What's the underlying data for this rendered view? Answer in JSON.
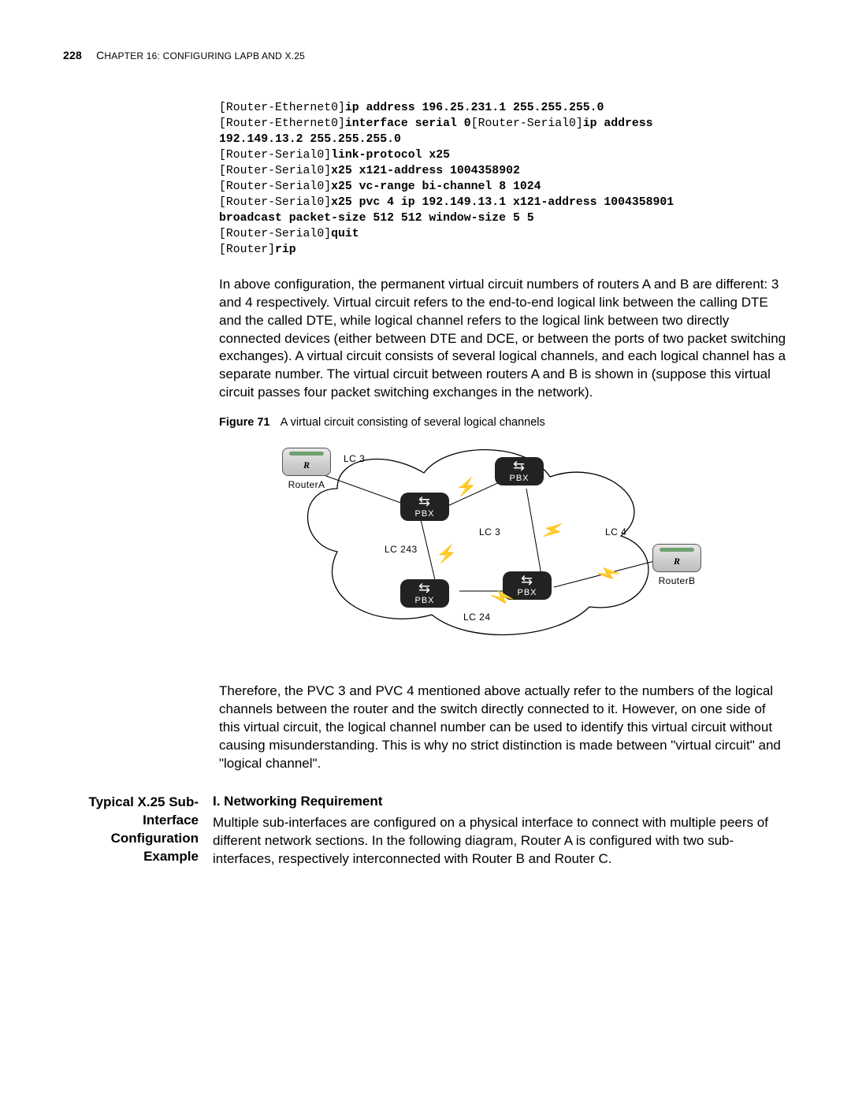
{
  "header": {
    "page_number": "228",
    "chapter_small_caps_prefix": "C",
    "chapter_rest": "HAPTER 16: CONFIGURING LAPB AND X.25"
  },
  "code": {
    "l1_prefix": "[Router-Ethernet0]",
    "l1_cmd": "ip address 196.25.231.1 255.255.255.0",
    "l2_prefix": "[Router-Ethernet0]",
    "l2_cmd": "interface serial 0",
    "l2_mid": "[Router-Serial0]",
    "l2_cmd2": "ip address",
    "l3_cmd": "192.149.13.2 255.255.255.0",
    "l4_prefix": "[Router-Serial0]",
    "l4_cmd": "link-protocol x25",
    "l5_prefix": "[Router-Serial0]",
    "l5_cmd": "x25 x121-address 1004358902",
    "l6_prefix": "[Router-Serial0]",
    "l6_cmd": "x25 vc-range bi-channel 8 1024",
    "l7_prefix": "[Router-Serial0]",
    "l7_cmd": "x25 pvc 4 ip 192.149.13.1 x121-address 1004358901",
    "l8_cmd": "broadcast packet-size 512 512 window-size 5 5",
    "l9_prefix": "[Router-Serial0]",
    "l9_cmd": "quit",
    "l10_prefix": "[Router]",
    "l10_cmd": "rip"
  },
  "para1": "In above configuration, the permanent virtual circuit numbers of routers A and B are different: 3 and 4 respectively. Virtual circuit refers to the end-to-end logical link between the calling DTE and the called DTE, while logical channel refers to the logical link between two directly connected devices (either between DTE and DCE, or between the ports of two packet switching exchanges). A virtual circuit consists of several logical channels, and each logical channel has a separate number. The virtual circuit between routers A and B is shown in (suppose this virtual circuit passes four packet switching exchanges in the network).",
  "figure": {
    "label": "Figure 71",
    "caption": "A virtual circuit consisting of several logical channels",
    "routerA": "RouterA",
    "routerB": "RouterB",
    "pbx": "PBX",
    "lc3a": "LC 3",
    "lc243": "LC 243",
    "lc3b": "LC 3",
    "lc24": "LC 24",
    "lc4": "LC 4"
  },
  "para2": "Therefore, the PVC 3 and PVC 4 mentioned above actually refer to the numbers of the logical channels between the router and the switch directly connected to it. However, on one side of this virtual circuit, the logical channel number can be used to identify this virtual circuit without causing misunderstanding. This is why no strict distinction is made between \"virtual circuit\" and \"logical channel\".",
  "section": {
    "side_label": "Typical X.25 Sub-Interface Configuration Example",
    "sub_head": "I. Networking Requirement",
    "body": "Multiple sub-interfaces are configured on a physical interface to connect with multiple peers of different network sections. In the following diagram, Router A is configured with two sub-interfaces, respectively interconnected with Router B and Router C."
  }
}
